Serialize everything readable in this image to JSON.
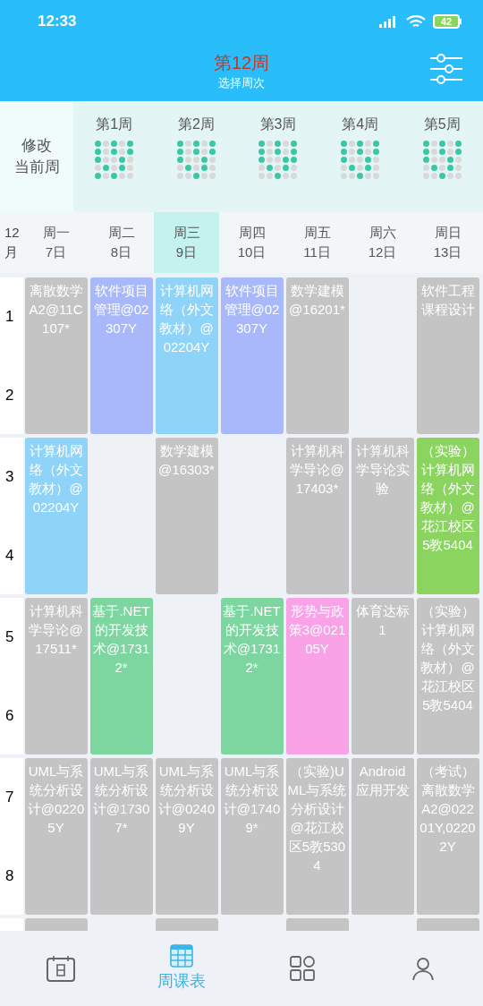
{
  "status_bar": {
    "time": "12:33",
    "battery": "42"
  },
  "header": {
    "title": "第12周",
    "subtitle": "选择周次"
  },
  "week_picker": {
    "current_label": [
      "修改",
      "当前周"
    ],
    "weeks": [
      {
        "label": "第1周",
        "dots": [
          [
            true,
            false,
            true,
            false,
            true
          ],
          [
            true,
            false,
            true,
            false,
            true
          ],
          [
            true,
            false,
            false,
            true,
            false
          ],
          [
            false,
            true,
            false,
            true,
            false
          ],
          [
            true,
            false,
            true,
            false,
            false
          ]
        ]
      },
      {
        "label": "第2周",
        "dots": [
          [
            true,
            false,
            true,
            false,
            true
          ],
          [
            true,
            false,
            true,
            false,
            true
          ],
          [
            true,
            false,
            false,
            true,
            false
          ],
          [
            false,
            true,
            false,
            true,
            false
          ],
          [
            false,
            false,
            true,
            false,
            false
          ]
        ]
      },
      {
        "label": "第3周",
        "dots": [
          [
            true,
            false,
            true,
            false,
            true
          ],
          [
            true,
            false,
            true,
            false,
            true
          ],
          [
            true,
            false,
            false,
            true,
            true
          ],
          [
            false,
            true,
            false,
            true,
            false
          ],
          [
            false,
            false,
            true,
            false,
            false
          ]
        ]
      },
      {
        "label": "第4周",
        "dots": [
          [
            true,
            false,
            true,
            false,
            true
          ],
          [
            true,
            false,
            true,
            false,
            true
          ],
          [
            true,
            false,
            false,
            true,
            false
          ],
          [
            false,
            true,
            false,
            true,
            false
          ],
          [
            false,
            false,
            true,
            false,
            false
          ]
        ]
      },
      {
        "label": "第5周",
        "dots": [
          [
            true,
            false,
            true,
            false,
            true
          ],
          [
            true,
            false,
            true,
            false,
            true
          ],
          [
            true,
            false,
            false,
            true,
            false
          ],
          [
            false,
            true,
            false,
            true,
            false
          ],
          [
            false,
            false,
            true,
            false,
            false
          ]
        ]
      }
    ]
  },
  "day_header": {
    "month": [
      "12",
      "月"
    ],
    "days": [
      {
        "weekday": "周一",
        "date": "7日",
        "selected": false
      },
      {
        "weekday": "周二",
        "date": "8日",
        "selected": false
      },
      {
        "weekday": "周三",
        "date": "9日",
        "selected": true
      },
      {
        "weekday": "周四",
        "date": "10日",
        "selected": false
      },
      {
        "weekday": "周五",
        "date": "11日",
        "selected": false
      },
      {
        "weekday": "周六",
        "date": "12日",
        "selected": false
      },
      {
        "weekday": "周日",
        "date": "13日",
        "selected": false
      }
    ]
  },
  "blocks": [
    {
      "periods": [
        "1",
        "2"
      ],
      "cells": [
        {
          "text": "离散数学A2@11C107*",
          "color": "#c4c4c4"
        },
        {
          "text": "软件项目管理@02307Y",
          "color": "#a9b8fb"
        },
        {
          "text": "计算机网络（外文教材）@02204Y",
          "color": "#8fd3f8"
        },
        {
          "text": "软件项目管理@02307Y",
          "color": "#a9b8fb"
        },
        {
          "text": "数学建模@16201*",
          "color": "#c4c4c4"
        },
        null,
        {
          "text": "软件工程课程设计",
          "color": "#c4c4c4"
        }
      ]
    },
    {
      "periods": [
        "3",
        "4"
      ],
      "cells": [
        {
          "text": "计算机网络（外文教材）@02204Y",
          "color": "#8fd3f8"
        },
        null,
        {
          "text": "数学建模@16303*",
          "color": "#c4c4c4"
        },
        null,
        {
          "text": "计算机科学导论@17403*",
          "color": "#c4c4c4"
        },
        {
          "text": "计算机科学导论实验",
          "color": "#c4c4c4"
        },
        {
          "text": "（实验）计算机网络（外文教材）@花江校区5教5404",
          "color": "#8ad45f"
        }
      ]
    },
    {
      "periods": [
        "5",
        "6"
      ],
      "cells": [
        {
          "text": "计算机科学导论@17511*",
          "color": "#c4c4c4"
        },
        {
          "text": "基于.NET的开发技术@17312*",
          "color": "#7dd6a0"
        },
        null,
        {
          "text": "基于.NET的开发技术@17312*",
          "color": "#7dd6a0"
        },
        {
          "text": "形势与政策3@02105Y",
          "color": "#f9a2e8"
        },
        {
          "text": "体育达标1",
          "color": "#c4c4c4"
        },
        {
          "text": "（实验）计算机网络（外文教材）@花江校区5教5404",
          "color": "#c4c4c4"
        }
      ]
    },
    {
      "periods": [
        "7",
        "8"
      ],
      "cells": [
        {
          "text": "UML与系统分析设计@02205Y",
          "color": "#c4c4c4"
        },
        {
          "text": "UML与系统分析设计@17307*",
          "color": "#c4c4c4"
        },
        {
          "text": "UML与系统分析设计@02409Y",
          "color": "#c4c4c4"
        },
        {
          "text": "UML与系统分析设计@17409*",
          "color": "#c4c4c4"
        },
        {
          "text": "（实验)UML与系统分析设计@花江校区5教5304",
          "color": "#c4c4c4"
        },
        {
          "text": "Android应用开发",
          "color": "#c4c4c4"
        },
        {
          "text": "（考试）离散数学A2@02201Y,02202Y",
          "color": "#c4c4c4"
        }
      ]
    }
  ],
  "partial_row": [
    {
      "occupied": true
    },
    {
      "occupied": false
    },
    {
      "occupied": true
    },
    {
      "occupied": false
    },
    {
      "occupied": true
    },
    {
      "occupied": false
    },
    {
      "occupied": true
    }
  ],
  "bottom_nav": [
    {
      "kind": "calendar",
      "selected": false
    },
    {
      "kind": "table",
      "label": "周课表",
      "selected": true
    },
    {
      "kind": "apps",
      "selected": false
    },
    {
      "kind": "profile",
      "selected": false
    }
  ]
}
